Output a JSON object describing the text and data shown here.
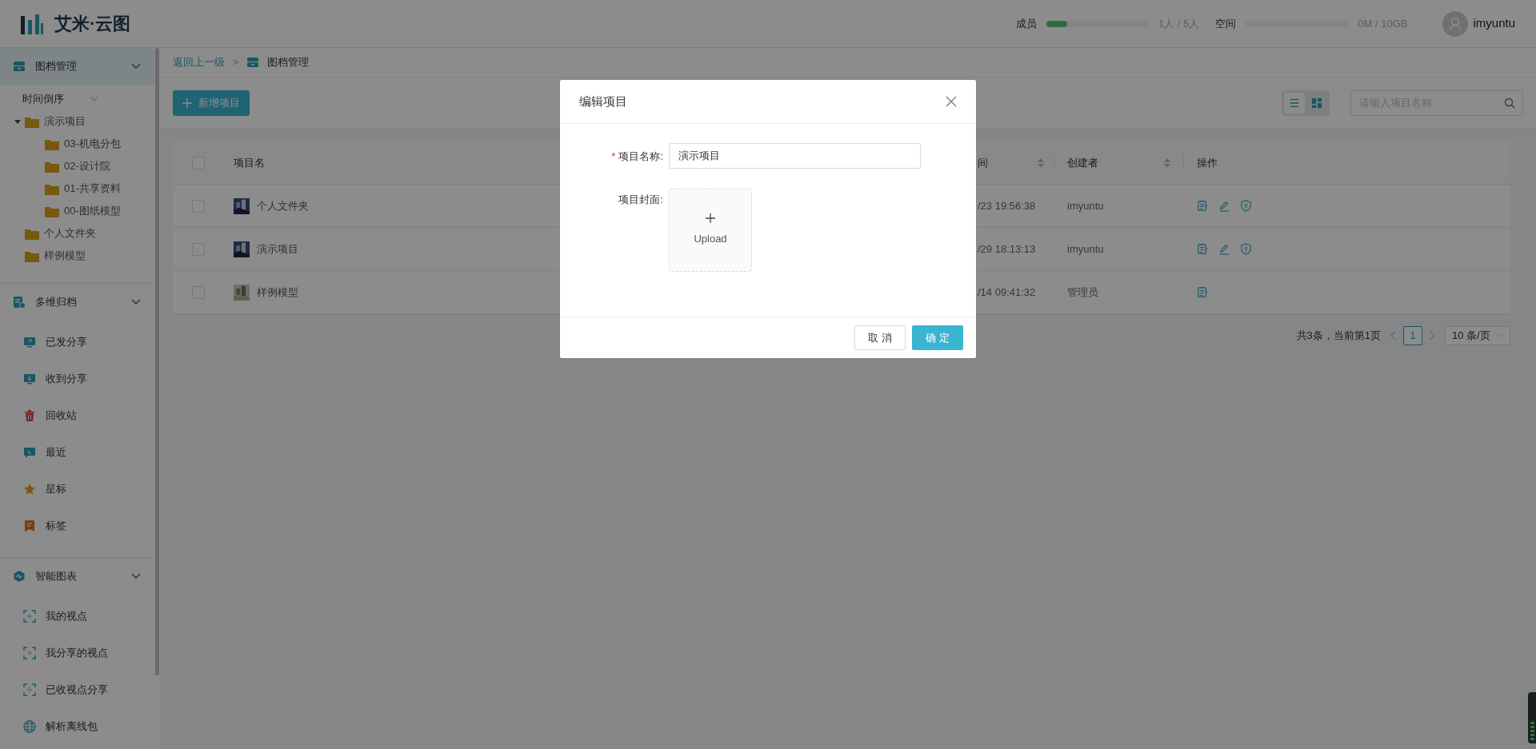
{
  "header": {
    "logo_text": "艾米·云图",
    "quotas": [
      {
        "label": "成员",
        "level": 0.2,
        "reading": "1人 / 5人"
      },
      {
        "label": "空间",
        "level": 0,
        "reading": "0M / 10GB"
      }
    ],
    "user": "imyuntu"
  },
  "sidebar": {
    "sections": [
      {
        "title": "图档管理",
        "selected": true,
        "expanded": true,
        "sort": "时间倒序",
        "tree": [
          {
            "label": "演示项目",
            "expanded": true,
            "children": [
              {
                "label": "03-机电分包"
              },
              {
                "label": "02-设计院"
              },
              {
                "label": "01-共享资料"
              },
              {
                "label": "00-图纸模型"
              }
            ]
          },
          {
            "label": "个人文件夹"
          },
          {
            "label": "样例模型"
          }
        ]
      },
      {
        "title": "多维归档",
        "selected": false,
        "expanded": true,
        "items": [
          {
            "label": "已发分享"
          },
          {
            "label": "收到分享"
          },
          {
            "label": "回收站"
          },
          {
            "label": "最近"
          },
          {
            "label": "星标"
          },
          {
            "label": "标签"
          }
        ]
      },
      {
        "title": "智能图表",
        "selected": false,
        "expanded": true,
        "items": [
          {
            "label": "我的视点"
          },
          {
            "label": "我分享的视点"
          },
          {
            "label": "已收视点分享"
          },
          {
            "label": "解析离线包"
          }
        ]
      }
    ]
  },
  "breadcrumb": {
    "back": "返回上一级",
    "separator": ">",
    "current": "图档管理"
  },
  "toolbar": {
    "new_button": "新增项目",
    "view_modes": [
      {
        "selected": true
      },
      {
        "selected": false
      }
    ],
    "search": {
      "placeholder": "请输入项目名称"
    }
  },
  "table": {
    "header_checked": false,
    "columns": [
      {
        "label": "项目名"
      },
      {
        "label": "间",
        "sortable": true
      },
      {
        "label": "创建者",
        "sortable": true
      },
      {
        "label": "操作"
      }
    ],
    "rows": [
      {
        "checked": false,
        "name": "个人文件夹",
        "time": "/23 19:56:38",
        "creator": "imyuntu",
        "actions": [
          {
            "kind": "notes"
          },
          {
            "kind": "edit"
          },
          {
            "kind": "permission"
          }
        ]
      },
      {
        "checked": false,
        "name": "演示项目",
        "time": "/29 18:13:13",
        "creator": "imyuntu",
        "actions": [
          {
            "kind": "notes"
          },
          {
            "kind": "edit"
          },
          {
            "kind": "permission"
          }
        ]
      },
      {
        "checked": false,
        "name": "样例模型",
        "time": "/14 09:41:32",
        "creator": "管理员",
        "actions": [
          {
            "kind": "notes"
          }
        ]
      }
    ]
  },
  "pagination": {
    "summary": "共3条，当前第1页",
    "pages": [
      {
        "label": "1",
        "selected": true
      }
    ],
    "page_size": "10 条/页"
  },
  "dialog": {
    "title": "编辑项目",
    "required_mark": "*",
    "fields": [
      {
        "kind": "text",
        "label": "项目名称:",
        "required": true,
        "value": "演示项目"
      },
      {
        "kind": "upload",
        "label": "项目封面:",
        "required": false,
        "upload_label": "Upload"
      }
    ],
    "buttons": [
      {
        "label": "取 消",
        "primary": false
      },
      {
        "label": "确 定",
        "primary": true
      }
    ]
  }
}
